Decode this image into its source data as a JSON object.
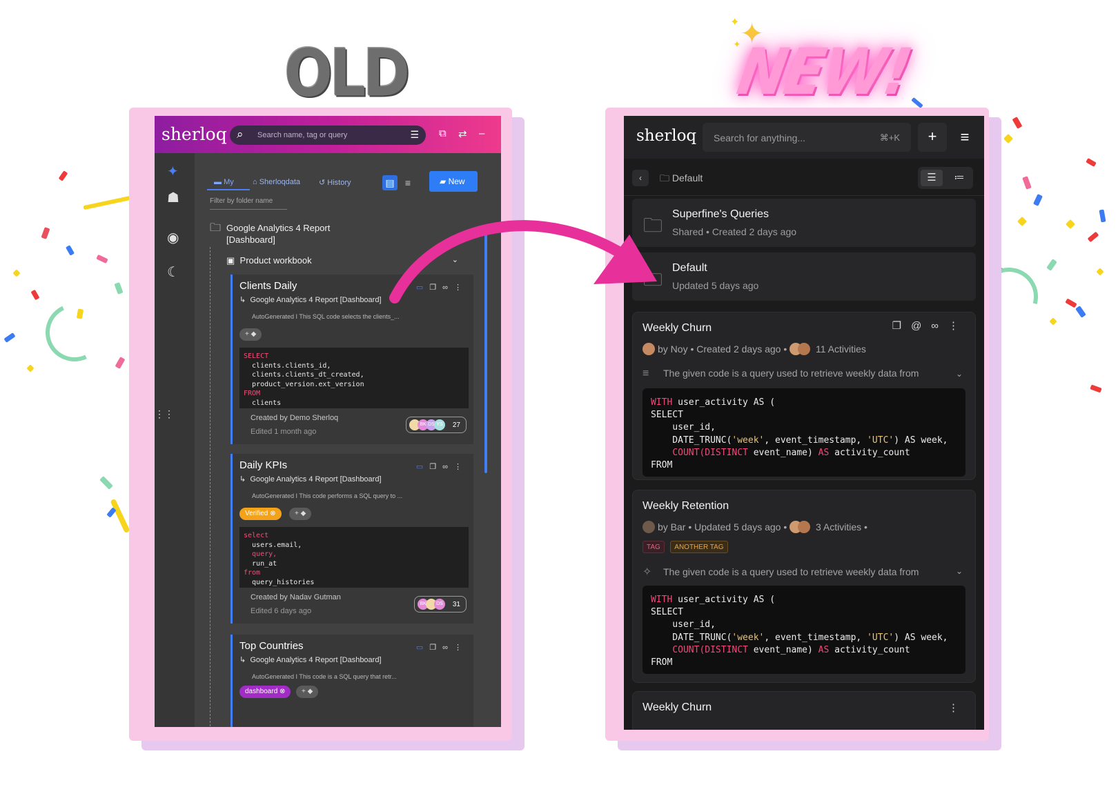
{
  "labels": {
    "old": "OLD",
    "new": "NEW!"
  },
  "colors": {
    "accent_pink": "#e8309a",
    "old_blue": "#3f7ff3",
    "frame_pink": "#f8c8e6",
    "frame_violet": "#e7c8ef"
  },
  "old": {
    "logo": "sherloq",
    "search_placeholder": "Search name, tag or query",
    "tabs": [
      "My",
      "Sherloqdata",
      "History"
    ],
    "new_button": "New",
    "filter_placeholder": "Filter by folder name",
    "folder": "Google Analytics 4 Report [Dashboard]",
    "workbook": "Product workbook",
    "cards": [
      {
        "title": "Clients Daily",
        "source": "Google Analytics 4 Report [Dashboard]",
        "desc": "AutoGenerated I This SQL code selects the clients_...",
        "chips": [
          "+"
        ],
        "code_lines": [
          "SELECT",
          "  clients.clients_id,",
          "  clients.clients_dt_created,",
          "  product_version.ext_version",
          "FROM",
          "  clients"
        ],
        "created_by": "Created by Demo Sherloq",
        "edited": "Edited 1 month ago",
        "avatars": [
          "BK",
          "DS",
          "YS"
        ],
        "count": "27"
      },
      {
        "title": "Daily KPIs",
        "source": "Google Analytics 4 Report [Dashboard]",
        "desc": "AutoGenerated I This code performs a SQL query to ...",
        "chips": [
          "Verified",
          "+"
        ],
        "code_lines": [
          "select",
          "  users.email,",
          "  query,",
          "  run_at",
          "from",
          "  query_histories"
        ],
        "created_by": "Created by Nadav Gutman",
        "edited": "Edited 6 days ago",
        "avatars": [
          "BK",
          "DS"
        ],
        "count": "31"
      },
      {
        "title": "Top Countries",
        "source": "Google Analytics 4 Report [Dashboard]",
        "desc": "AutoGenerated I This code is a SQL query that retr...",
        "chips": [
          "dashboard",
          "+"
        ]
      }
    ]
  },
  "new": {
    "logo": "sherloq",
    "search_placeholder": "Search for anything...",
    "shortcut": "⌘+K",
    "breadcrumb": "Default",
    "folders": [
      {
        "title": "Superfine's Queries",
        "meta": "Shared  •  Created 2 days ago"
      },
      {
        "title": "Default",
        "meta": "Updated 5 days ago"
      }
    ],
    "cards": [
      {
        "title": "Weekly Churn",
        "meta": "by Noy  •  Created 2 days ago  •",
        "activities": "11 Activities",
        "tags": [],
        "desc": "The given code is a query used to retrieve weekly data from"
      },
      {
        "title": "Weekly Retention",
        "meta": "by Bar  •  Updated 5 days ago  •",
        "activities": "3 Activities  •",
        "tags": [
          "TAG",
          "ANOTHER TAG"
        ],
        "desc": "The given code is a query used to retrieve weekly data from"
      },
      {
        "title": "Weekly Churn"
      }
    ],
    "code": {
      "l1a": "WITH",
      "l1b": " user_activity AS (",
      "l2": "SELECT",
      "l3": "    user_id,",
      "l4a": "    DATE_TRUNC(",
      "l4b": "'week'",
      "l4c": ", event_timestamp, ",
      "l4d": "'UTC'",
      "l4e": ") AS week,",
      "l5a": "    COUNT",
      "l5b": "(",
      "l5c": "DISTINCT",
      "l5d": " event_name) ",
      "l5e": "AS",
      "l5f": " activity_count",
      "l6": "FROM"
    }
  }
}
